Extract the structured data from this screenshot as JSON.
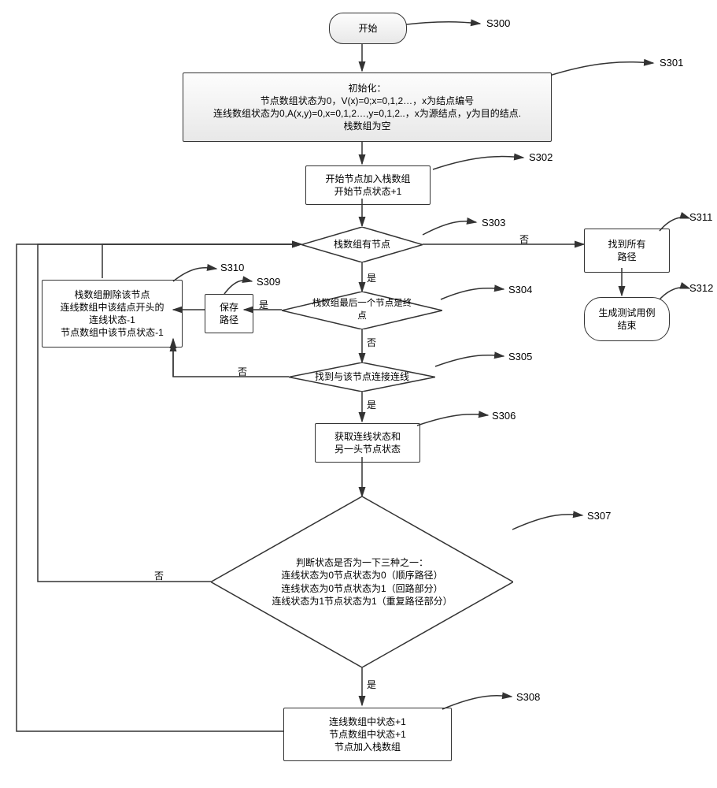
{
  "labels": {
    "S300": "S300",
    "S301": "S301",
    "S302": "S302",
    "S303": "S303",
    "S304": "S304",
    "S305": "S305",
    "S306": "S306",
    "S307": "S307",
    "S308": "S308",
    "S309": "S309",
    "S310": "S310",
    "S311": "S311",
    "S312": "S312"
  },
  "nodes": {
    "start": "开始",
    "init_title": "初始化：",
    "init_l1": "节点数组状态为0，V(x)=0;x=0,1,2…，x为结点编号",
    "init_l2": "连线数组状态为0,A(x,y)=0,x=0,1,2…,y=0,1,2..，x为源结点，y为目的结点.",
    "init_l3": "栈数组为空",
    "addstart_l1": "开始节点加入栈数组",
    "addstart_l2": "开始节点状态+1",
    "stack_has": "栈数组有节点",
    "found_all_l1": "找到所有",
    "found_all_l2": "路径",
    "gen_end_l1": "生成测试用例",
    "gen_end_l2": "结束",
    "last_is_end_l1": "栈数组最后一个节点是终",
    "last_is_end_l2": "点",
    "save_l1": "保存",
    "save_l2": "路径",
    "remove_node_l1": "栈数组删除该节点",
    "remove_node_l2": "连线数组中该结点开头的",
    "remove_node_l3": "连线状态-1",
    "remove_node_l4": "节点数组中该节点状态-1",
    "find_link": "找到与该节点连接连线",
    "get_state_l1": "获取连线状态和",
    "get_state_l2": "另一头节点状态",
    "judge_l1": "判断状态是否为一下三种之一：",
    "judge_l2": "连线状态为0节点状态为0（顺序路径）",
    "judge_l3": "连线状态为0节点状态为1（回路部分）",
    "judge_l4": "连线状态为1节点状态为1（重复路径部分）",
    "plus_l1": "连线数组中状态+1",
    "plus_l2": "节点数组中状态+1",
    "plus_l3": "节点加入栈数组"
  },
  "yn": {
    "yes": "是",
    "no": "否"
  }
}
